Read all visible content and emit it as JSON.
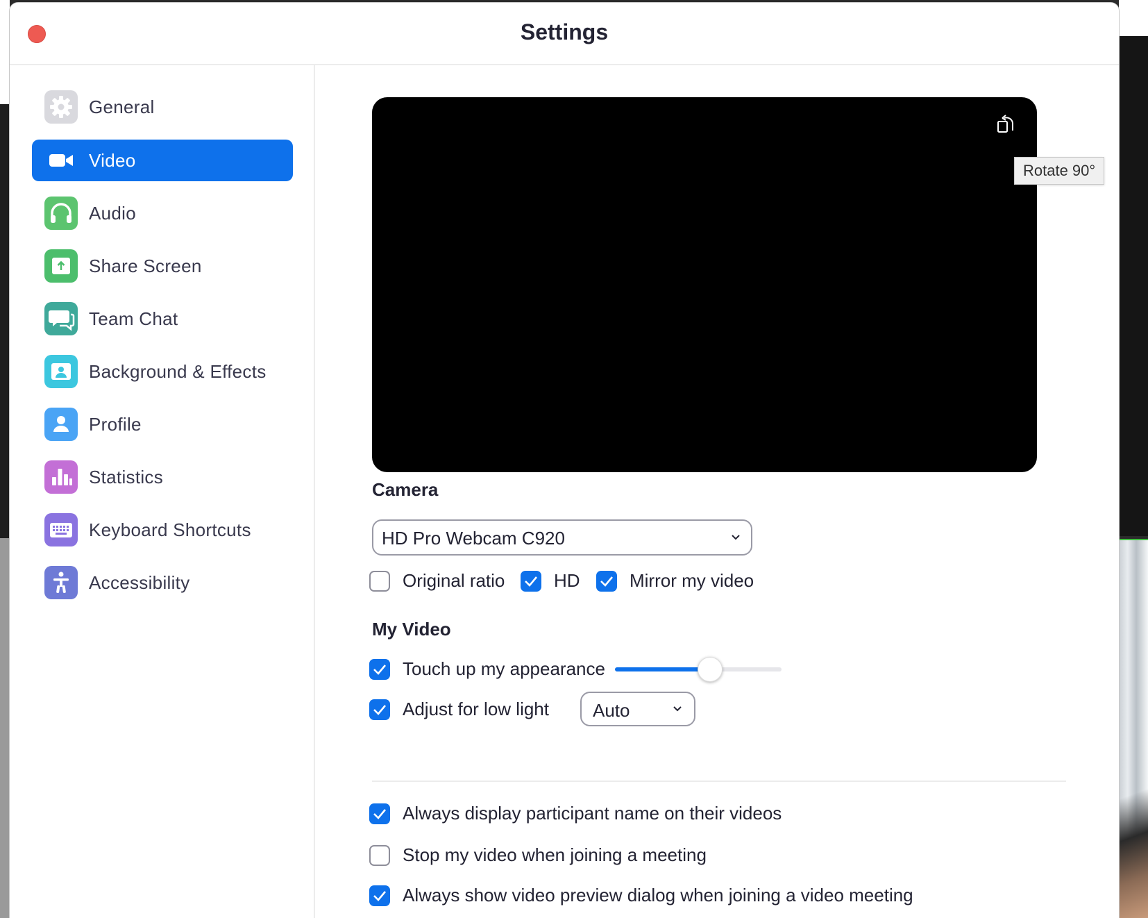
{
  "window": {
    "title": "Settings"
  },
  "sidebar": {
    "items": [
      {
        "label": "General",
        "icon": "gear-icon",
        "color": "#d9d9de",
        "active": false
      },
      {
        "label": "Video",
        "icon": "video-camera-icon",
        "color": "#0e71eb",
        "active": true
      },
      {
        "label": "Audio",
        "icon": "headphones-icon",
        "color": "#5cc46f",
        "active": false
      },
      {
        "label": "Share Screen",
        "icon": "share-screen-icon",
        "color": "#4cbe6c",
        "active": false
      },
      {
        "label": "Team Chat",
        "icon": "chat-bubble-icon",
        "color": "#3fa99a",
        "active": false
      },
      {
        "label": "Background & Effects",
        "icon": "background-person-icon",
        "color": "#3cc7df",
        "active": false
      },
      {
        "label": "Profile",
        "icon": "profile-person-icon",
        "color": "#4aa4f5",
        "active": false
      },
      {
        "label": "Statistics",
        "icon": "bar-chart-icon",
        "color": "#c36fd6",
        "active": false
      },
      {
        "label": "Keyboard Shortcuts",
        "icon": "keyboard-icon",
        "color": "#8a73e0",
        "active": false
      },
      {
        "label": "Accessibility",
        "icon": "accessibility-icon",
        "color": "#6e7ad6",
        "active": false
      }
    ]
  },
  "preview": {
    "rotate_tooltip": "Rotate 90°",
    "rotate_icon": "rotate-icon"
  },
  "camera": {
    "title": "Camera",
    "selected": "HD Pro Webcam C920",
    "options": [
      {
        "label": "Original ratio",
        "checked": false
      },
      {
        "label": "HD",
        "checked": true
      },
      {
        "label": "Mirror my video",
        "checked": true
      }
    ]
  },
  "my_video": {
    "title": "My Video",
    "touch_up": {
      "label": "Touch up my appearance",
      "checked": true,
      "level": 0.57
    },
    "low_light": {
      "label": "Adjust for low light",
      "checked": true,
      "mode": "Auto"
    }
  },
  "meeting_options": [
    {
      "label": "Always display participant name on their videos",
      "checked": true
    },
    {
      "label": "Stop my video when joining a meeting",
      "checked": false
    },
    {
      "label": "Always show video preview dialog when joining a video meeting",
      "checked": true
    }
  ],
  "colors": {
    "accent": "#0e71eb",
    "close": "#ee5a52"
  }
}
